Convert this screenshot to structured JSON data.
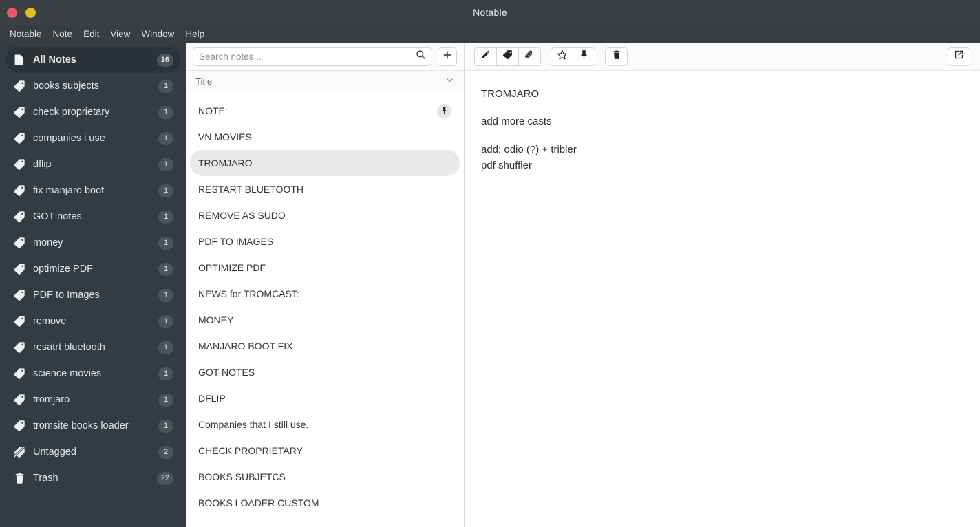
{
  "window": {
    "title": "Notable",
    "controls": [
      {
        "name": "close",
        "color": "#e9596a"
      },
      {
        "name": "minimize",
        "color": "#e8bb25"
      }
    ]
  },
  "menubar": {
    "items": [
      "Notable",
      "Note",
      "Edit",
      "View",
      "Window",
      "Help"
    ]
  },
  "sidebar": {
    "items": [
      {
        "label": "All Notes",
        "count": "16",
        "icon": "document-icon",
        "active": true
      },
      {
        "label": "books subjects",
        "count": "1",
        "icon": "tag-icon",
        "active": false
      },
      {
        "label": "check proprietary",
        "count": "1",
        "icon": "tag-icon",
        "active": false
      },
      {
        "label": "companies i use",
        "count": "1",
        "icon": "tag-icon",
        "active": false
      },
      {
        "label": "dflip",
        "count": "1",
        "icon": "tag-icon",
        "active": false
      },
      {
        "label": "fix manjaro boot",
        "count": "1",
        "icon": "tag-icon",
        "active": false
      },
      {
        "label": "GOT notes",
        "count": "1",
        "icon": "tag-icon",
        "active": false
      },
      {
        "label": "money",
        "count": "1",
        "icon": "tag-icon",
        "active": false
      },
      {
        "label": "optimize PDF",
        "count": "1",
        "icon": "tag-icon",
        "active": false
      },
      {
        "label": "PDF to Images",
        "count": "1",
        "icon": "tag-icon",
        "active": false
      },
      {
        "label": "remove",
        "count": "1",
        "icon": "tag-icon",
        "active": false
      },
      {
        "label": "resatrt bluetooth",
        "count": "1",
        "icon": "tag-icon",
        "active": false
      },
      {
        "label": "science movies",
        "count": "1",
        "icon": "tag-icon",
        "active": false
      },
      {
        "label": "tromjaro",
        "count": "1",
        "icon": "tag-icon",
        "active": false
      },
      {
        "label": "tromsite books loader",
        "count": "1",
        "icon": "tag-icon",
        "active": false
      },
      {
        "label": "Untagged",
        "count": "2",
        "icon": "tag-slash-icon",
        "active": false
      },
      {
        "label": "Trash",
        "count": "22",
        "icon": "trash-icon",
        "active": false
      }
    ]
  },
  "notelist": {
    "search": {
      "value": "",
      "placeholder": "Search notes..."
    },
    "search_icon": "search-icon",
    "new_note_icon": "plus-icon",
    "sort": {
      "label": "Title",
      "icon": "chevron-down-icon"
    },
    "items": [
      {
        "title": "NOTE:",
        "pinned": true,
        "selected": false
      },
      {
        "title": "VN MOVIES",
        "pinned": false,
        "selected": false
      },
      {
        "title": "TROMJARO",
        "pinned": false,
        "selected": true
      },
      {
        "title": "RESTART BLUETOOTH",
        "pinned": false,
        "selected": false
      },
      {
        "title": "REMOVE AS SUDO",
        "pinned": false,
        "selected": false
      },
      {
        "title": "PDF TO IMAGES",
        "pinned": false,
        "selected": false
      },
      {
        "title": "OPTIMIZE PDF",
        "pinned": false,
        "selected": false
      },
      {
        "title": "NEWS for TROMCAST:",
        "pinned": false,
        "selected": false
      },
      {
        "title": "MONEY",
        "pinned": false,
        "selected": false
      },
      {
        "title": "MANJARO BOOT FIX",
        "pinned": false,
        "selected": false
      },
      {
        "title": "GOT NOTES",
        "pinned": false,
        "selected": false
      },
      {
        "title": "DFLIP",
        "pinned": false,
        "selected": false
      },
      {
        "title": "Companies that I still use.",
        "pinned": false,
        "selected": false
      },
      {
        "title": "CHECK PROPRIETARY",
        "pinned": false,
        "selected": false
      },
      {
        "title": "BOOKS SUBJETCS",
        "pinned": false,
        "selected": false
      },
      {
        "title": "BOOKS LOADER CUSTOM",
        "pinned": false,
        "selected": false
      }
    ]
  },
  "editor": {
    "toolbar": {
      "edit_icon": "pencil-icon",
      "tag_icon": "tag-icon",
      "attachment_icon": "paperclip-icon",
      "favorite_icon": "star-icon",
      "pin_icon": "pin-icon",
      "delete_icon": "trash-icon",
      "open_external_icon": "external-link-icon"
    },
    "content": [
      "TROMJARO",
      "add more casts",
      "add: odio (?) + tribler\npdf shuffler"
    ]
  }
}
